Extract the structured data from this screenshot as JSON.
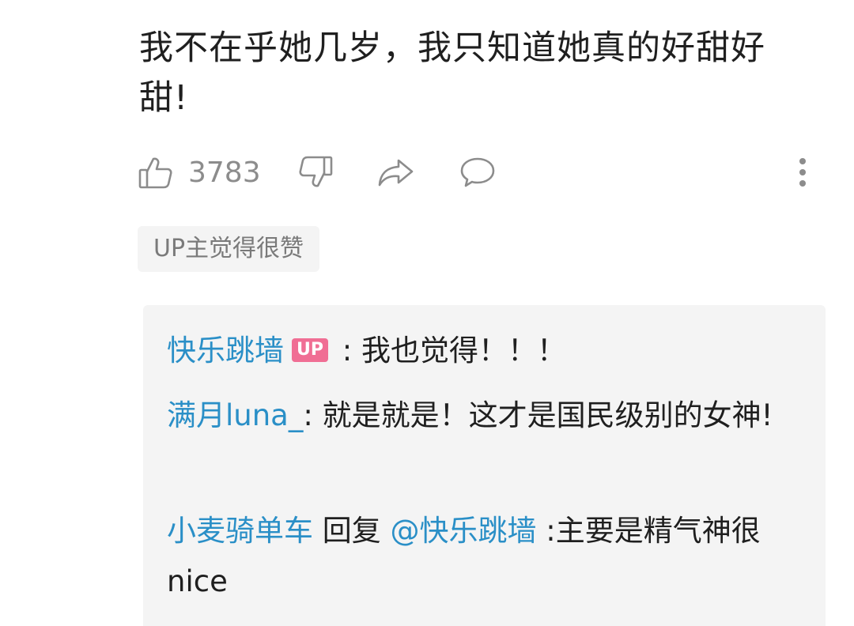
{
  "comment": {
    "text": "我不在乎她几岁，我只知道她真的好甜好甜!"
  },
  "actions": {
    "like_count": "3783",
    "icons": [
      "thumbs-up-icon",
      "thumbs-down-icon",
      "share-icon",
      "comment-icon",
      "more-icon"
    ]
  },
  "badge": {
    "label": "UP主觉得很赞"
  },
  "replies": [
    {
      "user": "快乐跳墙",
      "tag": "UP",
      "sep": " : ",
      "text": "我也觉得！！！"
    },
    {
      "user": "满月luna_",
      "sep": ": ",
      "text": "就是就是！这才是国民级别的女神!"
    },
    {
      "user": "小麦骑单车",
      "reply_word": " 回复 ",
      "mention": "@快乐跳墙",
      "sep": " :",
      "text": "主要是精气神很nice"
    }
  ],
  "colors": {
    "username": "#2a8fc7",
    "up_tag": "#f06e94",
    "icon_gray": "#8c8c8c",
    "panel_bg": "#f4f4f4"
  }
}
